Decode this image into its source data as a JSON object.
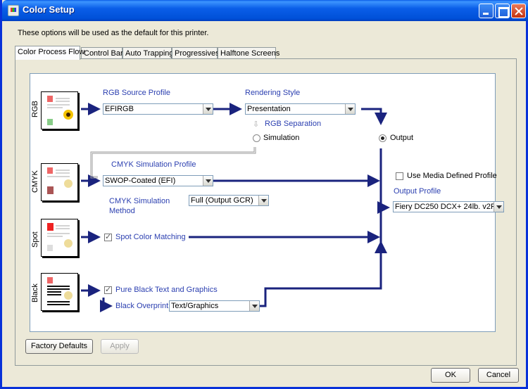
{
  "window": {
    "title": "Color Setup"
  },
  "description": "These options will be used as the default for this printer.",
  "tabs": [
    "Color Process Flow",
    "Control Bar",
    "Auto Trapping",
    "Progressives",
    "Halftone Screens"
  ],
  "rows": {
    "rgb": "RGB",
    "cmyk": "CMYK",
    "spot": "Spot",
    "black": "Black"
  },
  "rgb_source": {
    "label": "RGB Source Profile",
    "value": "EFIRGB"
  },
  "rendering": {
    "label": "Rendering Style",
    "value": "Presentation"
  },
  "rgb_separation": {
    "label": "RGB Separation",
    "option_simulation": "Simulation",
    "option_output": "Output",
    "selected": "Output"
  },
  "cmyk_sim": {
    "label": "CMYK Simulation Profile",
    "value": "SWOP-Coated (EFI)",
    "method_label_1": "CMYK Simulation",
    "method_label_2": "Method",
    "method_value": "Full (Output GCR)"
  },
  "spot": {
    "label": "Spot Color Matching",
    "checked": true
  },
  "black": {
    "pure_label": "Pure Black Text and Graphics",
    "pure_checked": true,
    "overprint_label": "Black Overprint",
    "overprint_value": "Text/Graphics"
  },
  "media_profile": {
    "label": "Use Media Defined Profile",
    "checked": false
  },
  "output_profile": {
    "label": "Output Profile",
    "value": "Fiery DC250 DCX+ 24lb. v2F"
  },
  "buttons": {
    "factory_defaults": "Factory Defaults",
    "apply": "Apply",
    "ok": "OK",
    "cancel": "Cancel"
  },
  "colors": {
    "flow_line": "#1a237e",
    "label_blue": "#2b3fb0"
  }
}
